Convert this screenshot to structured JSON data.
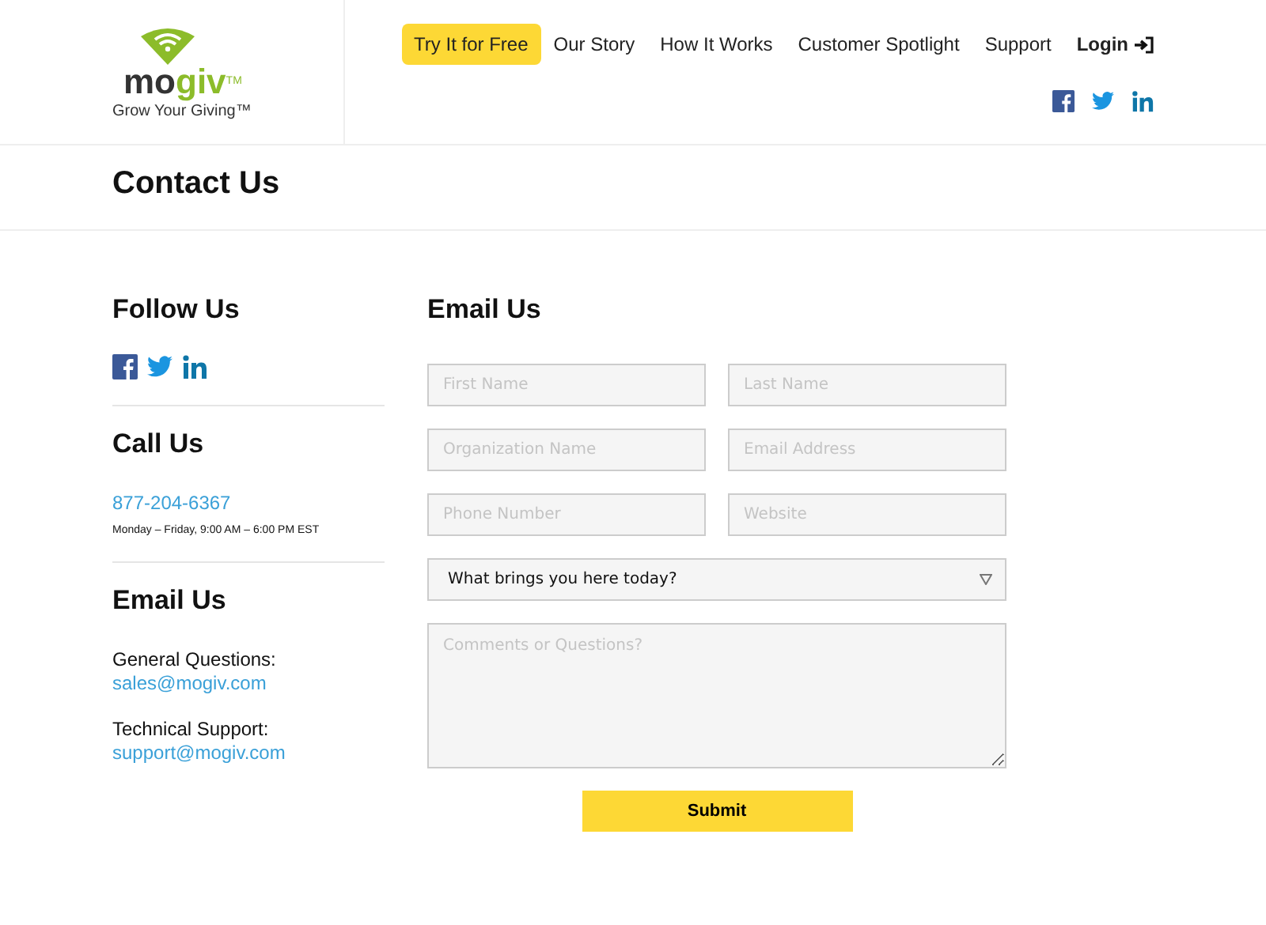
{
  "logo": {
    "word_start": "mo",
    "word_accent": "giv",
    "trademark": "TM",
    "tagline": "Grow Your Giving™"
  },
  "nav": [
    {
      "label": "Try It for Free",
      "kind": "cta"
    },
    {
      "label": "Our Story",
      "kind": "link"
    },
    {
      "label": "How It Works",
      "kind": "link"
    },
    {
      "label": "Customer Spotlight",
      "kind": "link"
    },
    {
      "label": "Support",
      "kind": "link"
    },
    {
      "label": "Login",
      "kind": "login"
    }
  ],
  "page_title": "Contact Us",
  "sidebar": {
    "follow_heading": "Follow Us",
    "call_heading": "Call Us",
    "phone": "877-204-6367",
    "hours": "Monday – Friday, 9:00 AM – 6:00 PM EST",
    "email_heading": "Email Us",
    "contacts": [
      {
        "label": "General Questions:",
        "email": "sales@mogiv.com"
      },
      {
        "label": "Technical Support:",
        "email": "support@mogiv.com"
      }
    ]
  },
  "form": {
    "heading": "Email Us",
    "fields": [
      {
        "placeholder": "First Name"
      },
      {
        "placeholder": "Last Name"
      },
      {
        "placeholder": "Organization Name"
      },
      {
        "placeholder": "Email Address"
      },
      {
        "placeholder": "Phone Number"
      },
      {
        "placeholder": "Website"
      }
    ],
    "select": {
      "value": "What brings you here today?"
    },
    "comments": {
      "placeholder": "Comments or Questions?"
    },
    "submit": "Submit"
  }
}
